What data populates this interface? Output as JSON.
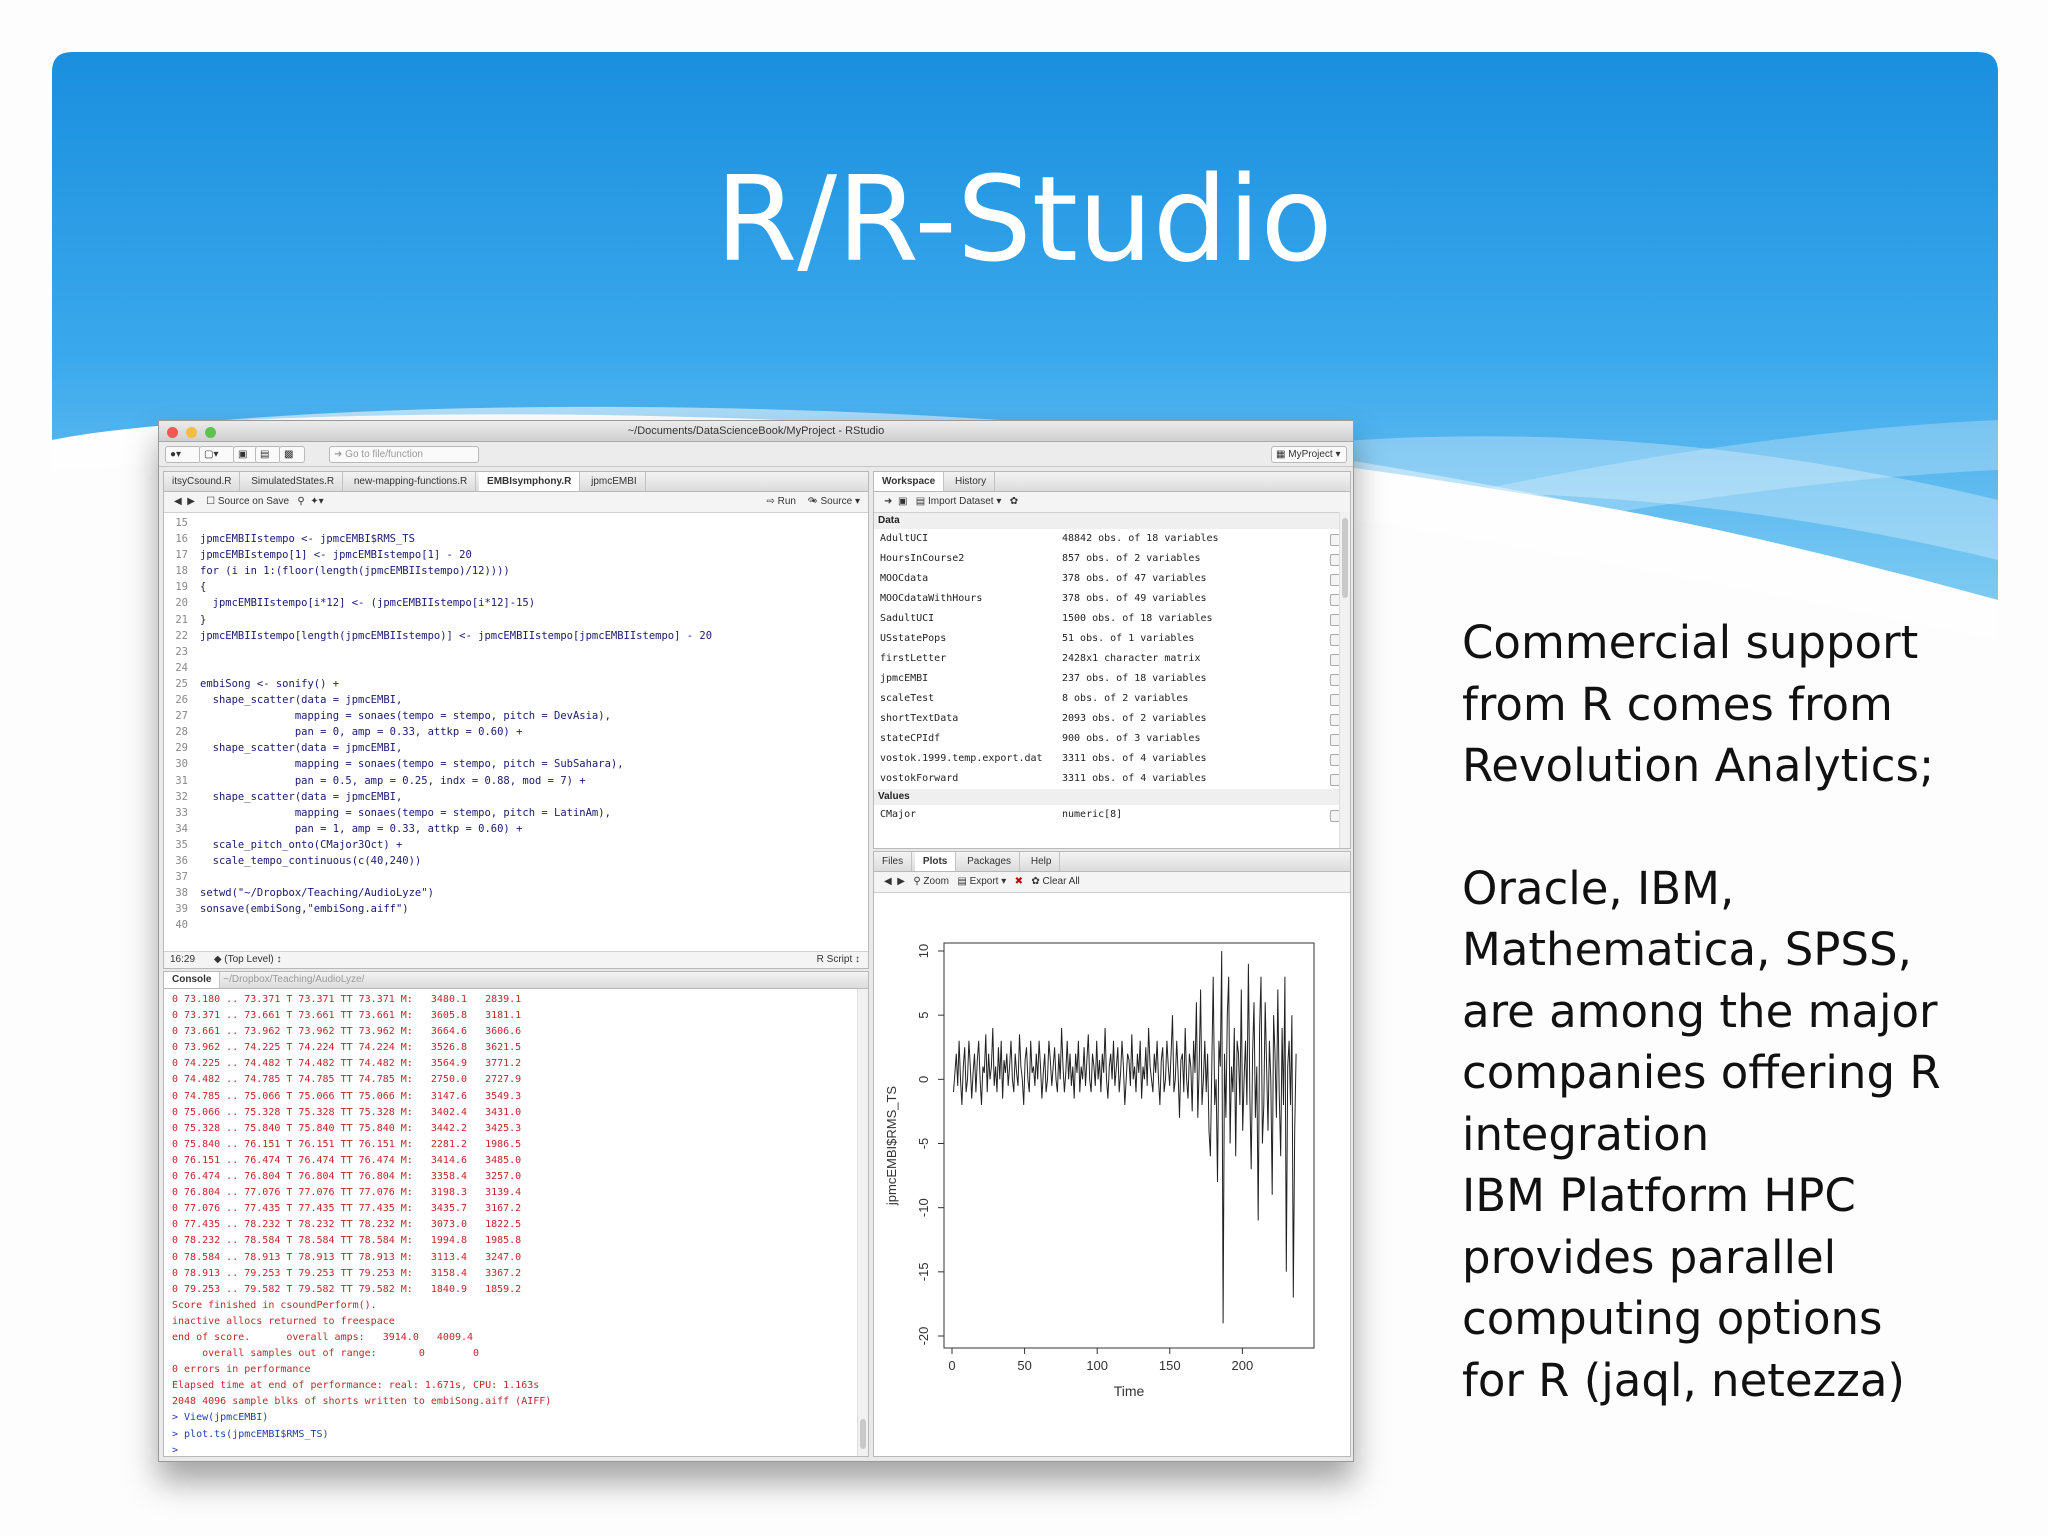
{
  "slide": {
    "title": "R/R-Studio",
    "paragraph1": [
      "Commercial support",
      "from R comes from",
      "Revolution Analytics;"
    ],
    "paragraph2": [
      "Oracle, IBM,",
      "Mathematica, SPSS,",
      "are among the major",
      "companies offering R",
      "integration",
      "IBM Platform HPC",
      "provides parallel",
      "computing options",
      "for R (jaql, netezza)"
    ],
    "colors": {
      "banner_top": "#1a8fde",
      "banner_bottom": "#6cc0f0",
      "text": "#111111"
    }
  },
  "window": {
    "title": "~/Documents/DataScienceBook/MyProject - RStudio",
    "project": "MyProject",
    "goto_placeholder": "Go to file/function"
  },
  "editor": {
    "tabs": [
      "itsyCsound.R",
      "SimulatedStates.R",
      "new-mapping-functions.R",
      "EMBIsymphony.R",
      "jpmcEMBI"
    ],
    "active_tab_index": 3,
    "source_on_save": "Source on Save",
    "run": "Run",
    "source": "Source",
    "lines": [
      {
        "n": "15",
        "t": ""
      },
      {
        "n": "16",
        "t": "jpmcEMBIIstempo <- jpmcEMBI$RMS_TS"
      },
      {
        "n": "17",
        "t": "jpmcEMBIstempo[1] <- jpmcEMBIstempo[1] - 20"
      },
      {
        "n": "18",
        "t": "for (i in 1:(floor(length(jpmcEMBIIstempo)/12))))"
      },
      {
        "n": "19",
        "t": "{"
      },
      {
        "n": "20",
        "t": "  jpmcEMBIIstempo[i*12] <- (jpmcEMBIIstempo[i*12]-15)"
      },
      {
        "n": "21",
        "t": "}"
      },
      {
        "n": "22",
        "t": "jpmcEMBIIstempo[length(jpmcEMBIIstempo)] <- jpmcEMBIIstempo[jpmcEMBIIstempo] - 20"
      },
      {
        "n": "23",
        "t": ""
      },
      {
        "n": "24",
        "t": ""
      },
      {
        "n": "25",
        "t": "embiSong <- sonify() +"
      },
      {
        "n": "26",
        "t": "  shape_scatter(data = jpmcEMBI,"
      },
      {
        "n": "27",
        "t": "               mapping = sonaes(tempo = stempo, pitch = DevAsia),"
      },
      {
        "n": "28",
        "t": "               pan = 0, amp = 0.33, attkp = 0.60) +"
      },
      {
        "n": "29",
        "t": "  shape_scatter(data = jpmcEMBI,"
      },
      {
        "n": "30",
        "t": "               mapping = sonaes(tempo = stempo, pitch = SubSahara),"
      },
      {
        "n": "31",
        "t": "               pan = 0.5, amp = 0.25, indx = 0.88, mod = 7) +"
      },
      {
        "n": "32",
        "t": "  shape_scatter(data = jpmcEMBI,"
      },
      {
        "n": "33",
        "t": "               mapping = sonaes(tempo = stempo, pitch = LatinAm),"
      },
      {
        "n": "34",
        "t": "               pan = 1, amp = 0.33, attkp = 0.60) +"
      },
      {
        "n": "35",
        "t": "  scale_pitch_onto(CMajor3Oct) +"
      },
      {
        "n": "36",
        "t": "  scale_tempo_continuous(c(40,240))"
      },
      {
        "n": "37",
        "t": ""
      },
      {
        "n": "38",
        "t": "setwd(\"~/Dropbox/Teaching/AudioLyze\")"
      },
      {
        "n": "39",
        "t": "sonsave(embiSong,\"embiSong.aiff\")"
      },
      {
        "n": "40",
        "t": ""
      }
    ],
    "status_pos": "16:29",
    "status_level": "(Top Level)",
    "status_type": "R Script"
  },
  "console": {
    "title": "Console",
    "path": "~/Dropbox/Teaching/AudioLyze/",
    "lines": [
      "0 73.180 .. 73.371 T 73.371 TT 73.371 M:   3480.1   2839.1",
      "0 73.371 .. 73.661 T 73.661 TT 73.661 M:   3605.8   3181.1",
      "0 73.661 .. 73.962 T 73.962 TT 73.962 M:   3664.6   3606.6",
      "0 73.962 .. 74.225 T 74.224 TT 74.224 M:   3526.8   3621.5",
      "0 74.225 .. 74.482 T 74.482 TT 74.482 M:   3564.9   3771.2",
      "0 74.482 .. 74.785 T 74.785 TT 74.785 M:   2750.0   2727.9",
      "0 74.785 .. 75.066 T 75.066 TT 75.066 M:   3147.6   3549.3",
      "0 75.066 .. 75.328 T 75.328 TT 75.328 M:   3402.4   3431.0",
      "0 75.328 .. 75.840 T 75.840 TT 75.840 M:   3442.2   3425.3",
      "0 75.840 .. 76.151 T 76.151 TT 76.151 M:   2281.2   1986.5",
      "0 76.151 .. 76.474 T 76.474 TT 76.474 M:   3414.6   3485.0",
      "0 76.474 .. 76.804 T 76.804 TT 76.804 M:   3358.4   3257.0",
      "0 76.804 .. 77.076 T 77.076 TT 77.076 M:   3198.3   3139.4",
      "0 77.076 .. 77.435 T 77.435 TT 77.435 M:   3435.7   3167.2",
      "0 77.435 .. 78.232 T 78.232 TT 78.232 M:   3073.0   1822.5",
      "0 78.232 .. 78.584 T 78.584 TT 78.584 M:   1994.8   1985.8",
      "0 78.584 .. 78.913 T 78.913 TT 78.913 M:   3113.4   3247.0",
      "0 78.913 .. 79.253 T 79.253 TT 79.253 M:   3158.4   3367.2",
      "0 79.253 .. 79.582 T 79.582 TT 79.582 M:   1840.9   1859.2",
      "Score finished in csoundPerform().",
      "inactive allocs returned to freespace",
      "end of score.      overall amps:   3914.0   4009.4",
      "     overall samples out of range:       0        0",
      "0 errors in performance",
      "Elapsed time at end of performance: real: 1.671s, CPU: 1.163s",
      "2048 4096 sample blks of shorts written to embiSong.aiff (AIFF)"
    ],
    "commands": [
      "> View(jpmcEMBI)",
      "> plot.ts(jpmcEMBI$RMS_TS)",
      ">"
    ]
  },
  "workspace": {
    "tabs": [
      "Workspace",
      "History"
    ],
    "import": "Import Dataset",
    "data_header": "Data",
    "values_header": "Values",
    "rows": [
      {
        "name": "AdultUCI",
        "value": "48842 obs. of 18 variables"
      },
      {
        "name": "HoursInCourse2",
        "value": "857 obs. of 2 variables"
      },
      {
        "name": "MOOCdata",
        "value": "378 obs. of 47 variables"
      },
      {
        "name": "MOOCdataWithHours",
        "value": "378 obs. of 49 variables"
      },
      {
        "name": "SadultUCI",
        "value": "1500 obs. of 18 variables"
      },
      {
        "name": "USstatePops",
        "value": "51 obs. of 1 variables"
      },
      {
        "name": "firstLetter",
        "value": "2428x1 character matrix"
      },
      {
        "name": "jpmcEMBI",
        "value": "237 obs. of 18 variables"
      },
      {
        "name": "scaleTest",
        "value": "8 obs. of 2 variables"
      },
      {
        "name": "shortTextData",
        "value": "2093 obs. of 2 variables"
      },
      {
        "name": "stateCPIdf",
        "value": "900 obs. of 3 variables"
      },
      {
        "name": "vostok.1999.temp.export.dat",
        "value": "3311 obs. of 4 variables"
      },
      {
        "name": "vostokForward",
        "value": "3311 obs. of 4 variables"
      }
    ],
    "value_rows": [
      {
        "name": "CMajor",
        "value": "numeric[8]"
      }
    ]
  },
  "plots": {
    "tabs": [
      "Files",
      "Plots",
      "Packages",
      "Help"
    ],
    "active_tab_index": 1,
    "zoom": "Zoom",
    "export": "Export",
    "clear_all": "Clear All"
  },
  "chart_data": {
    "type": "line",
    "title": "",
    "xlabel": "Time",
    "ylabel": "jpmcEMBI$RMS_TS",
    "xlim": [
      0,
      237
    ],
    "ylim": [
      -20,
      10
    ],
    "xticks": [
      "0",
      "50",
      "100",
      "150",
      "200"
    ],
    "yticks": [
      "10",
      "5",
      "0",
      "-5",
      "-10",
      "-15",
      "-20"
    ],
    "series": [
      {
        "values": [
          -1,
          0.5,
          2,
          -0.5,
          3,
          0,
          -2,
          1,
          2.5,
          -1,
          0,
          3,
          1,
          -1.5,
          0.5,
          2,
          -1,
          1.5,
          3,
          0,
          -2,
          1,
          0.5,
          3.5,
          -1,
          2,
          0,
          1,
          4,
          -0.5,
          1,
          -1,
          2.5,
          0,
          3,
          -1.5,
          1.5,
          0.5,
          2,
          -0.5,
          1,
          3,
          0,
          -1,
          2,
          0.5,
          -0.5,
          3.5,
          1,
          0,
          -2,
          1.5,
          2.5,
          0,
          -1,
          3,
          0.5,
          1,
          -0.5,
          2,
          0,
          3,
          1,
          -1.5,
          0.5,
          2,
          -1,
          0,
          3,
          1.5,
          -0.5,
          1,
          2.5,
          0,
          -1,
          2,
          0,
          4,
          1,
          -1,
          0.5,
          3,
          0,
          2,
          -0.5,
          1,
          -1.5,
          2,
          0.5,
          3,
          -1,
          1,
          0,
          2.5,
          -0.5,
          1.5,
          3.5,
          0,
          -1,
          2,
          1,
          -0.5,
          3,
          0,
          1.5,
          -1,
          2,
          0.5,
          4,
          0,
          -1.5,
          1,
          2,
          0,
          3,
          -0.5,
          1,
          2.5,
          -1,
          0.5,
          3,
          1,
          -2,
          0,
          2,
          1.5,
          -0.5,
          3.5,
          0,
          1,
          -1,
          2,
          0.5,
          3,
          -1.5,
          1,
          0,
          2.5,
          -0.5,
          4,
          1,
          0,
          -1,
          2,
          0.5,
          3,
          0,
          -2,
          1.5,
          2.5,
          -1,
          0,
          3,
          1,
          -0.5,
          2,
          5,
          -1,
          0,
          3,
          0.5,
          -3,
          1.5,
          2,
          -1,
          4,
          0,
          -1.5,
          2,
          1,
          -2.5,
          3,
          0.5,
          6,
          -3,
          1,
          7,
          -2,
          0,
          3,
          -1,
          2,
          -4,
          -6,
          1,
          8,
          -2,
          0,
          -8,
          3,
          1,
          10,
          -19,
          2,
          -3,
          5,
          8,
          -5,
          1,
          -1,
          4,
          -6,
          3,
          2,
          -2,
          7,
          -4,
          0,
          3,
          -2,
          9,
          -1,
          -7,
          2,
          6,
          -3,
          1,
          -11,
          4,
          8,
          -5,
          -2,
          6,
          1,
          -4,
          3,
          0,
          -9,
          5,
          2,
          -3,
          7,
          -1,
          -6,
          4,
          -2,
          8,
          -15,
          1,
          3,
          -2,
          5,
          -17,
          -4,
          2
        ]
      }
    ]
  }
}
